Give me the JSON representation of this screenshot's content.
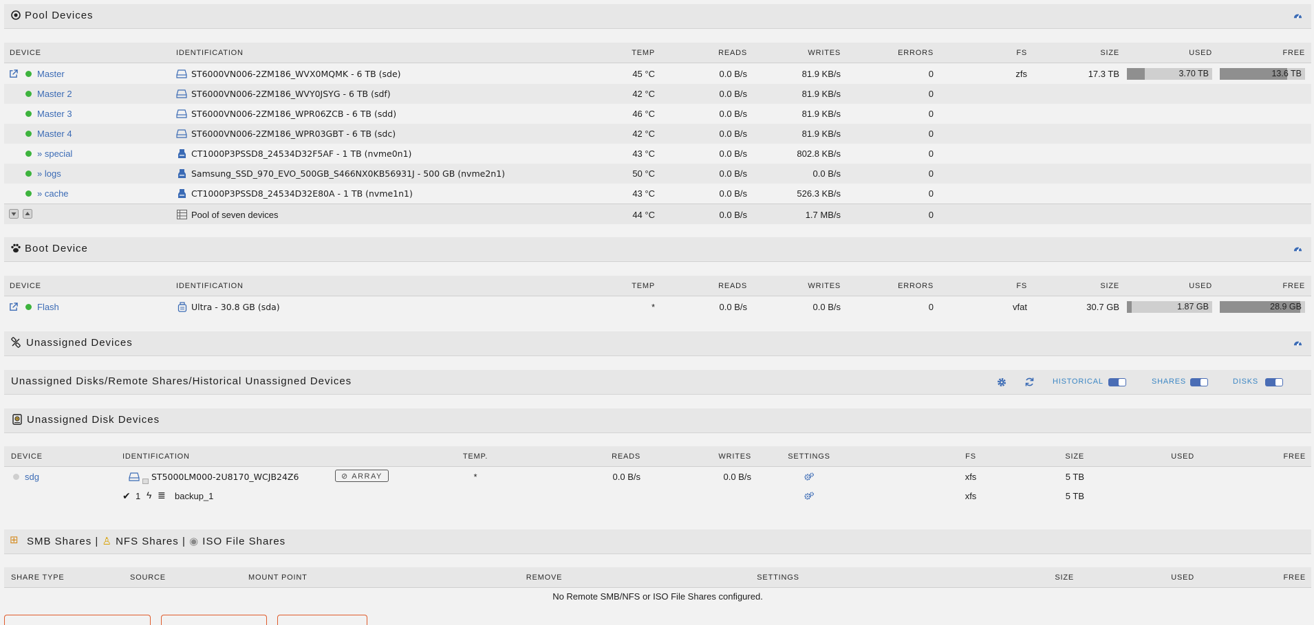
{
  "pool": {
    "title": "Pool Devices",
    "headers": {
      "device": "DEVICE",
      "identification": "IDENTIFICATION",
      "temp": "TEMP",
      "reads": "READS",
      "writes": "WRITES",
      "errors": "ERRORS",
      "fs": "FS",
      "size": "SIZE",
      "used": "USED",
      "free": "FREE"
    },
    "rows": [
      {
        "device": "Master",
        "ident": "ST6000VN006-2ZM186_WVX0MQMK - 6 TB (sde)",
        "temp": "45 °C",
        "reads": "0.0 B/s",
        "writes": "81.9 KB/s",
        "errors": "0",
        "fs": "zfs",
        "size": "17.3 TB",
        "used": "3.70 TB",
        "free": "13.6 TB",
        "used_fraction": 0.21,
        "free_fraction": 0.79
      },
      {
        "device": "Master 2",
        "ident": "ST6000VN006-2ZM186_WVY0JSYG - 6 TB (sdf)",
        "temp": "42 °C",
        "reads": "0.0 B/s",
        "writes": "81.9 KB/s",
        "errors": "0"
      },
      {
        "device": "Master 3",
        "ident": "ST6000VN006-2ZM186_WPR06ZCB - 6 TB (sdd)",
        "temp": "46 °C",
        "reads": "0.0 B/s",
        "writes": "81.9 KB/s",
        "errors": "0"
      },
      {
        "device": "Master 4",
        "ident": "ST6000VN006-2ZM186_WPR03GBT - 6 TB (sdc)",
        "temp": "42 °C",
        "reads": "0.0 B/s",
        "writes": "81.9 KB/s",
        "errors": "0"
      },
      {
        "device": "» special",
        "ident": "CT1000P3PSSD8_24534D32F5AF - 1 TB (nvme0n1)",
        "temp": "43 °C",
        "reads": "0.0 B/s",
        "writes": "802.8 KB/s",
        "errors": "0"
      },
      {
        "device": "» logs",
        "ident": "Samsung_SSD_970_EVO_500GB_S466NX0KB56931J - 500 GB (nvme2n1)",
        "temp": "50 °C",
        "reads": "0.0 B/s",
        "writes": "0.0 B/s",
        "errors": "0"
      },
      {
        "device": "» cache",
        "ident": "CT1000P3PSSD8_24534D32E80A - 1 TB (nvme1n1)",
        "temp": "43 °C",
        "reads": "0.0 B/s",
        "writes": "526.3 KB/s",
        "errors": "0"
      }
    ],
    "footer": {
      "ident": "Pool of seven devices",
      "temp": "44 °C",
      "reads": "0.0 B/s",
      "writes": "1.7 MB/s",
      "errors": "0"
    }
  },
  "boot": {
    "title": "Boot Device",
    "row": {
      "device": "Flash",
      "ident": "Ultra - 30.8 GB (sda)",
      "temp": "*",
      "reads": "0.0 B/s",
      "writes": "0.0 B/s",
      "errors": "0",
      "fs": "vfat",
      "size": "30.7 GB",
      "used": "1.87 GB",
      "free": "28.9 GB",
      "used_fraction": 0.06,
      "free_fraction": 0.94
    }
  },
  "unassigned": {
    "title": "Unassigned Devices",
    "subtitle": "Unassigned Disks/Remote Shares/Historical Unassigned Devices",
    "toggles": {
      "historical": "HISTORICAL",
      "shares": "SHARES",
      "disks": "DISKS"
    },
    "disk_title": "Unassigned Disk Devices",
    "headers": {
      "device": "DEVICE",
      "identification": "IDENTIFICATION",
      "temp": "TEMP.",
      "reads": "READS",
      "writes": "WRITES",
      "settings": "SETTINGS",
      "fs": "FS",
      "size": "SIZE",
      "used": "USED",
      "free": "FREE"
    },
    "disk": {
      "device": "sdg",
      "ident": "ST5000LM000-2U8170_WCJB24Z6",
      "array_label": "ARRAY",
      "temp": "*",
      "reads": "0.0 B/s",
      "writes": "0.0 B/s",
      "fs": "xfs",
      "size": "5 TB"
    },
    "partition": {
      "num": "1",
      "name": "backup_1",
      "fs": "xfs",
      "size": "5 TB"
    }
  },
  "shares": {
    "title_smb": "SMB Shares",
    "sep": "|",
    "title_nfs": "NFS Shares",
    "title_iso": "ISO File Shares",
    "headers": {
      "share_type": "SHARE TYPE",
      "source": "SOURCE",
      "mount_point": "MOUNT POINT",
      "remove": "REMOVE",
      "settings": "SETTINGS",
      "size": "SIZE",
      "used": "USED",
      "free": "FREE"
    },
    "empty": "No Remote SMB/NFS or ISO File Shares configured."
  },
  "colors": {
    "link": "#3b6bb5",
    "online": "#3db33d",
    "offline": "#cfcfcf",
    "toggle": "#4a6db5",
    "accent": "#e05b2b"
  }
}
